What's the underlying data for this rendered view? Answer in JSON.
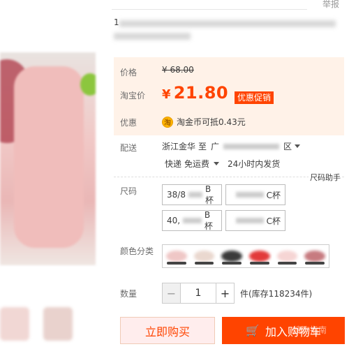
{
  "header": {
    "report_label": "举报"
  },
  "title": {
    "mark": "1"
  },
  "price": {
    "original_label": "价格",
    "original_value": "¥ 68.00",
    "taobao_label": "淘宝价",
    "currency": "¥",
    "current_value": "21.80",
    "promo_badge": "优惠促销"
  },
  "coupon": {
    "label": "优惠",
    "icon_char": "淘",
    "text": "淘金币可抵0.43元"
  },
  "delivery": {
    "label": "配送",
    "from": "浙江金华",
    "to_word": "至",
    "to_prefix": "广",
    "to_suffix": "区",
    "method": "快递",
    "fee": "免运费",
    "ship_time": "24小时内发货"
  },
  "size_helper": "尺码助手",
  "size": {
    "label": "尺码",
    "options": [
      {
        "prefix": "38/8",
        "suffix": "B杯"
      },
      {
        "prefix": "",
        "suffix": "C杯"
      },
      {
        "prefix": "40,",
        "suffix": "B杯"
      },
      {
        "prefix": "",
        "suffix": "C杯"
      }
    ]
  },
  "color": {
    "label": "颜色分类",
    "swatches": [
      "#efc7c6",
      "#ead8cf",
      "#3a3a3a",
      "#e23a3a",
      "#f6d5d4",
      "#c77b80"
    ]
  },
  "quantity": {
    "label": "数量",
    "minus": "−",
    "value": "1",
    "plus": "+",
    "stock": "件(库存118234件)"
  },
  "actions": {
    "buy_now": "立即购买",
    "add_cart": "加入购物车",
    "cart_icon": "🛒"
  },
  "watermark": "搜狗指南"
}
